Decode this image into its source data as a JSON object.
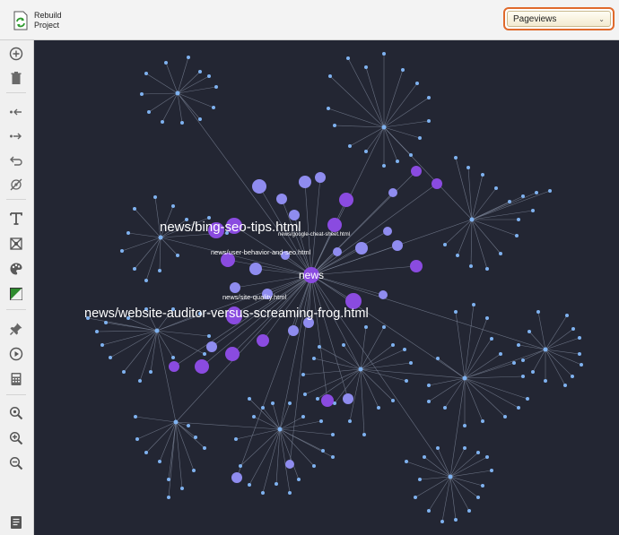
{
  "toolbar": {
    "rebuild_label": "Rebuild Project",
    "metric_select": {
      "selected": "Pageviews"
    }
  },
  "sidebar": {
    "tools": [
      "add-icon",
      "delete-icon",
      "collapse-left-icon",
      "expand-right-icon",
      "undo-icon",
      "target-icon",
      "text-icon",
      "expand-icon",
      "palette-icon",
      "color-toggle-icon",
      "pin-icon",
      "play-icon",
      "calculator-icon",
      "zoom-fit-icon",
      "zoom-in-icon",
      "zoom-out-icon",
      "notes-icon"
    ]
  },
  "graph": {
    "labels": {
      "hub": "news",
      "bing": "news/bing-seo-tips.html",
      "auditor": "news/website-auditor-versus-screaming-frog.html",
      "behavior": "news/user-behavior-and-seo.html",
      "quality": "news/site-quality.html",
      "google_sheet": "news/google-cheat-sheet.html"
    },
    "colors": {
      "background": "#232633",
      "light_node": "#7fb2f0",
      "mid_node": "#8f8cef",
      "dark_node": "#8a4be0",
      "edge": "#7c8497"
    }
  }
}
